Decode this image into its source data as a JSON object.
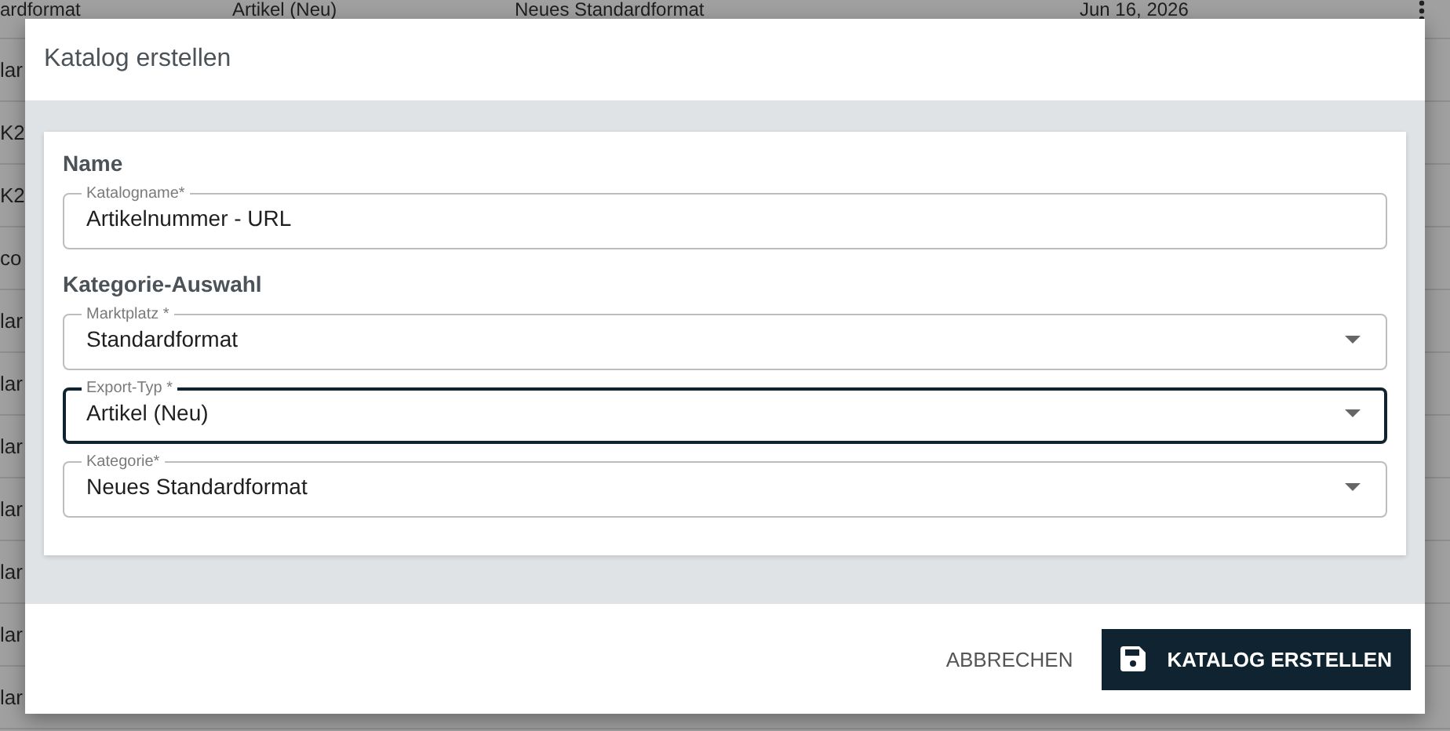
{
  "background_table": {
    "rows": [
      {
        "column_1": "ardformat",
        "column_2": "Artikel (Neu)",
        "column_3": "Neues Standardformat",
        "column_4": "Jun 16, 2026"
      },
      {
        "column_1": "lar"
      },
      {
        "column_1": "K2"
      },
      {
        "column_1": "K2"
      },
      {
        "column_1": "co"
      },
      {
        "column_1": "lar"
      },
      {
        "column_1": "lar"
      },
      {
        "column_1": "lar"
      },
      {
        "column_1": "lar"
      },
      {
        "column_1": "lar"
      },
      {
        "column_1": "lar"
      },
      {
        "column_1": "lar"
      }
    ]
  },
  "dialog": {
    "title": "Katalog erstellen",
    "sections": [
      {
        "heading": "Name",
        "fields": [
          {
            "kind": "text",
            "label": "Katalogname*",
            "value": "Artikelnummer - URL",
            "focused": false
          }
        ]
      },
      {
        "heading": "Kategorie-Auswahl",
        "fields": [
          {
            "kind": "select",
            "label": "Marktplatz *",
            "value": "Standardformat",
            "focused": false
          },
          {
            "kind": "select",
            "label": "Export-Typ *",
            "value": "Artikel (Neu)",
            "focused": true
          },
          {
            "kind": "select",
            "label": "Kategorie*",
            "value": "Neues Standardformat",
            "focused": false
          }
        ]
      }
    ],
    "buttons": [
      {
        "kind": "text",
        "label": "ABBRECHEN"
      },
      {
        "kind": "primary",
        "label": "KATALOG ERSTELLEN"
      }
    ]
  }
}
